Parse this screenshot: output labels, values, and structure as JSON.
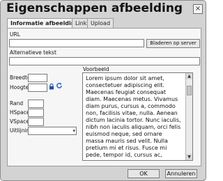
{
  "window": {
    "title": "Eigenschappen afbeelding",
    "close_glyph": "×"
  },
  "tabs": [
    {
      "label": "Informatie afbeelding",
      "active": true
    },
    {
      "label": "Link",
      "active": false
    },
    {
      "label": "Upload",
      "active": false
    }
  ],
  "form": {
    "url_label": "URL",
    "url_value": "",
    "browse_label": "Bladeren op server",
    "alt_label": "Alternatieve tekst",
    "alt_value": "",
    "width_label": "Breedte",
    "width_value": "",
    "height_label": "Hoogte",
    "height_value": "",
    "border_label": "Rand",
    "border_value": "",
    "hspace_label": "HSpace",
    "hspace_value": "",
    "vspace_label": "VSpace",
    "vspace_value": "",
    "align_label": "Uitlijning",
    "align_value": ""
  },
  "icons": {
    "lock": "lock-icon",
    "reset": "reset-size-icon"
  },
  "preview": {
    "label": "Voorbeeld",
    "text": "Lorem ipsum dolor sit amet, consectetuer adipiscing elit. Maecenas feugiat consequat diam. Maecenas metus. Vivamus diam purus, cursus a, commodo non, facilisis vitae, nulla. Aenean dictum lacinia tortor. Nunc iaculis, nibh non iaculis aliquam, orci felis euismod neque, sed ornare massa mauris sed velit. Nulla pretium mi et risus. Fusce mi pede, tempor id, cursus ac,"
  },
  "footer": {
    "ok_label": "OK",
    "cancel_label": "Annuleren"
  },
  "colors": {
    "dialog_bg": "#d3d3d3",
    "panel_bg": "#f6f6f6",
    "lock_icon": "#1e4f9c",
    "reset_icon": "#2b6fd1"
  }
}
